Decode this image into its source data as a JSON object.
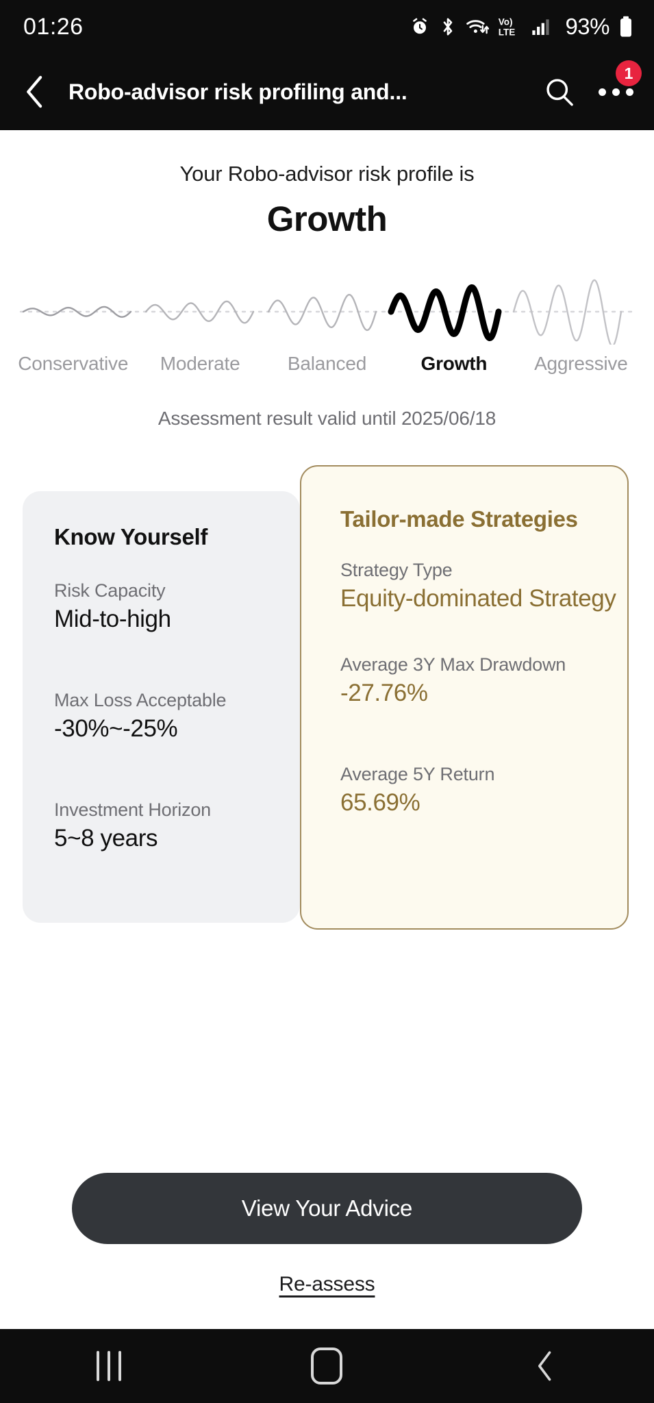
{
  "status_bar": {
    "time": "01:26",
    "battery_percent": "93%",
    "network_label": "LTE",
    "volte_label": "Vo)",
    "icons": [
      "alarm-icon",
      "bluetooth-icon",
      "wifi-icon",
      "volte-icon",
      "signal-icon",
      "battery-icon"
    ]
  },
  "app_bar": {
    "back_label": "‹",
    "title": "Robo-advisor risk profiling and...",
    "search_icon": "search-icon",
    "overflow_icon": "more-options-icon",
    "badge_count": "1"
  },
  "result": {
    "lead_text": "Your Robo-advisor risk profile is",
    "profile_name": "Growth",
    "valid_until": "Assessment result valid until 2025/06/18"
  },
  "chart_data": {
    "type": "line",
    "title": "Risk profile scale",
    "categories": [
      "Conservative",
      "Moderate",
      "Balanced",
      "Growth",
      "Aggressive"
    ],
    "values": [
      1,
      2,
      3,
      4,
      5
    ],
    "active_index": 3,
    "active_category": "Growth",
    "series": [
      {
        "name": "Conservative",
        "amplitude": 8,
        "cycles": 3,
        "color": "#9d9da2",
        "active": false
      },
      {
        "name": "Moderate",
        "amplitude": 17,
        "cycles": 3,
        "color": "#b4b4b8",
        "active": false
      },
      {
        "name": "Balanced",
        "amplitude": 28,
        "cycles": 3,
        "color": "#b4b4b8",
        "active": false
      },
      {
        "name": "Growth",
        "amplitude": 40,
        "cycles": 3,
        "color": "#000000",
        "active": true
      },
      {
        "name": "Aggressive",
        "amplitude": 52,
        "cycles": 3,
        "color": "#c2c2c6",
        "active": false
      }
    ],
    "baseline": "dotted",
    "xlabel": "",
    "ylabel": "",
    "grid": false,
    "legend": "bottom"
  },
  "know_yourself": {
    "title": "Know Yourself",
    "fields": [
      {
        "label": "Risk Capacity",
        "value": "Mid-to-high"
      },
      {
        "label": "Max Loss Acceptable",
        "value": "-30%~-25%"
      },
      {
        "label": "Investment Horizon",
        "value": "5~8 years"
      }
    ]
  },
  "tailor_made": {
    "title": "Tailor-made Strategies",
    "accent_color": "#8a6f33",
    "fields": [
      {
        "label": "Strategy Type",
        "value": "Equity-dominated Strategy"
      },
      {
        "label": "Average 3Y Max Drawdown",
        "value": "-27.76%"
      },
      {
        "label": "Average 5Y Return",
        "value": "65.69%"
      }
    ]
  },
  "footer": {
    "cta_label": "View Your Advice",
    "reassess_label": "Re-assess"
  },
  "nav_bar": {
    "recent_icon": "recent-apps-icon",
    "home_icon": "home-icon",
    "back_icon": "back-icon"
  }
}
